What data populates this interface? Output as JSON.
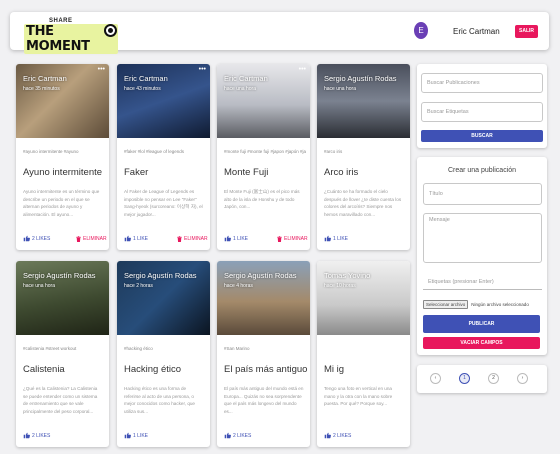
{
  "header": {
    "logo_top": "SHARE",
    "logo_main": "THE MOMENT",
    "avatar_initial": "E",
    "username": "Eric Cartman",
    "logout_label": "SALIR"
  },
  "labels": {
    "like": "LIKE",
    "likes_suffix": "LIKES",
    "delete": "ELIMINAR"
  },
  "posts": [
    {
      "author": "Eric Cartman",
      "time": "hace 35 minutos",
      "tags": "#ayuno intermitente #ayuno",
      "title": "Ayuno intermitente",
      "desc": "Ayuno intermitente es un término que describe un periodo en el que se alternan periodos de ayuno y alimentación. El ayuno...",
      "likes": "2 LIKES",
      "deletable": true
    },
    {
      "author": "Eric Cartman",
      "time": "hace 43 minutos",
      "tags": "#faker #lol #league of legends",
      "title": "Faker",
      "desc": "Al Faker de League of Legends es imposible no pensar en Lee \"Faker\" Sang-hyeok (surcoreano: 이상혁 자), el mejor jugador...",
      "likes": "1 LIKE",
      "deletable": true
    },
    {
      "author": "Eric Cartman",
      "time": "hace una hora",
      "tags": "#monte fuji #monte fuji #japon #japón #japón",
      "title": "Monte Fuji",
      "desc": "El Monte Fuji (富士山) es el pico más alto de la isla de Honshu y de todo Japón, con...",
      "likes": "1 LIKE",
      "deletable": true
    },
    {
      "author": "Sergio Agustín Rodas",
      "time": "hace una hora",
      "tags": "#arco iris",
      "title": "Arco iris",
      "desc": "¿Cuánto se ha formado el cielo después de llover ¿te diste cuenta los colores del arcoíris? Siempre nos hemos maravillado con...",
      "likes": "1 LIKE",
      "deletable": false
    },
    {
      "author": "Sergio Agustín Rodas",
      "time": "hace una hora",
      "tags": "#calistenia #street workout",
      "title": "Calistenia",
      "desc": "¿Qué es la Calistenia? La Calistenia se puede entender como un sistema de entrenamiento que se vale principalmente del peso corporal...",
      "likes": "2 LIKES",
      "deletable": false
    },
    {
      "author": "Sergio Agustín Rodas",
      "time": "hace 2 horas",
      "tags": "#hacking ético",
      "title": "Hacking ético",
      "desc": "Hacking ético es una forma de referirse al acto de una persona, o mejor conocidos como hacker, que utiliza sus...",
      "likes": "1 LIKE",
      "deletable": false
    },
    {
      "author": "Sergio Agustín Rodas",
      "time": "hace 4 horas",
      "tags": "#San Marino",
      "title": "El país más antiguo",
      "desc": "El país más antiguo del mundo está en Europa... Quizás no sea sorprendente que el país más longevo del mundo es...",
      "likes": "2 LIKES",
      "deletable": false
    },
    {
      "author": "Tomas Yovino",
      "time": "hace 10 horas",
      "tags": "",
      "title": "Mi ig",
      "desc": "Tengo una foto en vertical en una mano y la otra con la mano sobre puesta. Por qué? Porque soy...",
      "likes": "2 LIKES",
      "deletable": false
    }
  ],
  "search": {
    "posts_placeholder": "Buscar Publicaciones",
    "tags_placeholder": "Buscar Etiquetas",
    "button": "BUSCAR"
  },
  "create": {
    "title": "Crear una publicación",
    "title_placeholder": "Título",
    "message_placeholder": "Mensaje",
    "tags_placeholder": "Etiquetas (presionar Enter)",
    "file_button": "Seleccionar archivo",
    "file_status": "Ningún archivo seleccionado",
    "submit": "PUBLICAR",
    "clear": "VACIAR CAMPOS"
  },
  "pagination": {
    "prev": "‹",
    "next": "›",
    "pages": [
      "1",
      "2"
    ],
    "current": "1"
  }
}
